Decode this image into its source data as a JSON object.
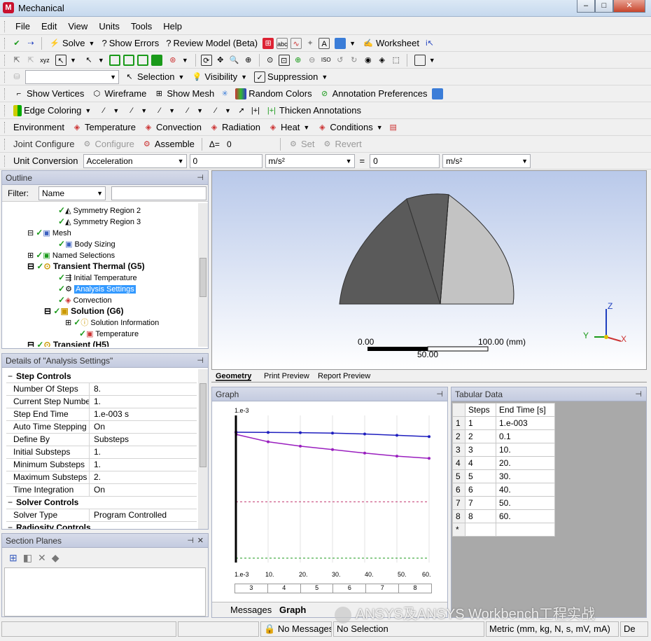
{
  "window": {
    "title": "Mechanical",
    "logo": "M"
  },
  "menu": [
    "File",
    "Edit",
    "View",
    "Units",
    "Tools",
    "Help"
  ],
  "toolbar1": {
    "solve": "Solve",
    "show_errors": "Show Errors",
    "review_model": "Review Model (Beta)",
    "worksheet": "Worksheet"
  },
  "toolbar3": {
    "selection": "Selection",
    "visibility": "Visibility",
    "suppression": "Suppression"
  },
  "toolbar4": {
    "show_vertices": "Show Vertices",
    "wireframe": "Wireframe",
    "show_mesh": "Show Mesh",
    "random_colors": "Random Colors",
    "annotation_prefs": "Annotation Preferences"
  },
  "toolbar5": {
    "edge_coloring": "Edge Coloring",
    "thicken": "Thicken Annotations"
  },
  "toolbar6": {
    "environment": "Environment",
    "temperature": "Temperature",
    "convection": "Convection",
    "radiation": "Radiation",
    "heat": "Heat",
    "conditions": "Conditions"
  },
  "toolbar7": {
    "joint_configure": "Joint Configure",
    "configure": "Configure",
    "assemble": "Assemble",
    "delta": "Δ=",
    "delta_value": "0",
    "set": "Set",
    "revert": "Revert"
  },
  "toolbar8": {
    "unit_conversion": "Unit Conversion",
    "quantity": "Acceleration",
    "value1": "0",
    "unit1": "m/s²",
    "equals": "=",
    "value2": "0",
    "unit2": "m/s²"
  },
  "outline": {
    "title": "Outline",
    "filter_label": "Filter:",
    "filter_value": "Name",
    "items": [
      "Symmetry Region 2",
      "Symmetry Region 3",
      "Mesh",
      "Body Sizing",
      "Named Selections",
      "Transient Thermal (G5)",
      "Initial Temperature",
      "Analysis Settings",
      "Convection",
      "Solution (G6)",
      "Solution Information",
      "Temperature",
      "Transient (H5)"
    ]
  },
  "details": {
    "title": "Details of \"Analysis Settings\"",
    "sections": {
      "step_controls": "Step Controls",
      "solver_controls": "Solver Controls",
      "radiosity_controls": "Radiosity Controls"
    },
    "rows": [
      {
        "k": "Number Of Steps",
        "v": "8."
      },
      {
        "k": "Current Step Number",
        "v": "1."
      },
      {
        "k": "Step End Time",
        "v": "1.e-003 s"
      },
      {
        "k": "Auto Time Stepping",
        "v": "On"
      },
      {
        "k": "Define By",
        "v": "Substeps"
      },
      {
        "k": "Initial Substeps",
        "v": "1."
      },
      {
        "k": "Minimum Substeps",
        "v": "1."
      },
      {
        "k": "Maximum Substeps",
        "v": "2."
      },
      {
        "k": "Time Integration",
        "v": "On"
      },
      {
        "k": "Solver Type",
        "v": "Program Controlled"
      }
    ]
  },
  "section_planes": {
    "title": "Section Planes"
  },
  "viewport": {
    "scale_left": "0.00",
    "scale_right": "100.00 (mm)",
    "scale_mid": "50.00",
    "axis_x": "X",
    "axis_y": "Y",
    "axis_z": "Z",
    "tabs": [
      "Geometry",
      "Print Preview",
      "Report Preview"
    ]
  },
  "graph": {
    "title": "Graph",
    "ytop": "1.e-3",
    "xticks": [
      "1.e-3",
      "10.",
      "20.",
      "30.",
      "40.",
      "50.",
      "60."
    ],
    "steps": [
      "3",
      "4",
      "5",
      "6",
      "7",
      "8"
    ],
    "bottom_tabs": [
      "Messages",
      "Graph"
    ]
  },
  "chart_data": {
    "type": "line",
    "x": [
      0.001,
      0.1,
      10,
      20,
      30,
      40,
      50,
      60
    ],
    "xlim": [
      0,
      60
    ],
    "series": [
      {
        "color": "#1f1fbf",
        "values": [
          1.0,
          1.0,
          0.995,
          0.99,
          0.98,
          0.96,
          0.93,
          0.9
        ]
      },
      {
        "color": "#9a1fbf",
        "values": [
          1.0,
          0.95,
          0.78,
          0.68,
          0.6,
          0.52,
          0.45,
          0.4
        ]
      }
    ],
    "dashed_levels": [
      {
        "color": "#c0306a",
        "value": -0.6
      },
      {
        "color": "#1f9a1f",
        "value": -1.9
      }
    ]
  },
  "tabular": {
    "title": "Tabular Data",
    "headers": [
      "Steps",
      "End Time [s]"
    ],
    "rows": [
      [
        "1",
        "1",
        "1.e-003"
      ],
      [
        "2",
        "2",
        "0.1"
      ],
      [
        "3",
        "3",
        "10."
      ],
      [
        "4",
        "4",
        "20."
      ],
      [
        "5",
        "5",
        "30."
      ],
      [
        "6",
        "6",
        "40."
      ],
      [
        "7",
        "7",
        "50."
      ],
      [
        "8",
        "8",
        "60."
      ],
      [
        "*",
        "",
        ""
      ]
    ]
  },
  "watermark": "ANSYS及ANSYS Workbench工程实战",
  "status": {
    "no_messages": "No Messages",
    "no_selection": "No Selection",
    "units": "Metric (mm, kg, N, s, mV, mA)",
    "degrees": "De"
  }
}
